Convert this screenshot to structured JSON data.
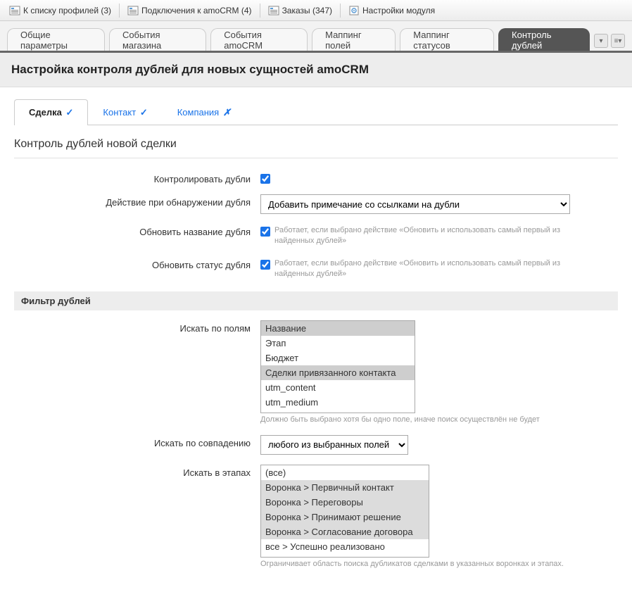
{
  "toolbar": {
    "profiles": "К списку профилей (3)",
    "connections": "Подключения к amoCRM (4)",
    "orders": "Заказы (347)",
    "settings": "Настройки модуля"
  },
  "outer_tabs": [
    "Общие параметры",
    "События магазина",
    "События amoCRM",
    "Маппинг полей",
    "Маппинг статусов",
    "Контроль дублей"
  ],
  "page_title": "Настройка контроля дублей для новых сущностей amoCRM",
  "inner_tabs": {
    "deal": "Сделка",
    "contact": "Контакт",
    "company": "Компания"
  },
  "section_title": "Контроль дублей новой сделки",
  "form": {
    "control_label": "Контролировать дубли",
    "action_label": "Действие при обнаружении дубля",
    "action_value": "Добавить примечание со ссылками на дубли",
    "update_name_label": "Обновить название дубля",
    "update_name_hint": "Работает, если выбрано действие «Обновить и использовать самый первый из найденных дублей»",
    "update_status_label": "Обновить статус дубля",
    "update_status_hint": "Работает, если выбрано действие «Обновить и использовать самый первый из найденных дублей»"
  },
  "filter": {
    "header": "Фильтр дублей",
    "fields_label": "Искать по полям",
    "fields_hint": "Должно быть выбрано хотя бы одно поле, иначе поиск осуществлён не будет",
    "match_label": "Искать по совпадению",
    "match_value": "любого из выбранных полей",
    "stages_label": "Искать в этапах",
    "stages_hint": "Ограничивает область поиска дубликатов сделками в указанных воронках и этапах."
  },
  "field_options": [
    {
      "label": "Название",
      "selected": true
    },
    {
      "label": "Этап",
      "selected": false
    },
    {
      "label": "Бюджет",
      "selected": false
    },
    {
      "label": "Сделки привязанного контакта",
      "selected": true
    },
    {
      "label": "utm_content",
      "selected": false
    },
    {
      "label": "utm_medium",
      "selected": false
    }
  ],
  "stage_options": [
    {
      "label": "(все)",
      "selected": false
    },
    {
      "label": "Воронка > Первичный контакт",
      "selected": true
    },
    {
      "label": "Воронка > Переговоры",
      "selected": true
    },
    {
      "label": "Воронка > Принимают решение",
      "selected": true
    },
    {
      "label": "Воронка > Согласование договора",
      "selected": true
    },
    {
      "label": "все > Успешно реализовано",
      "selected": false
    }
  ]
}
